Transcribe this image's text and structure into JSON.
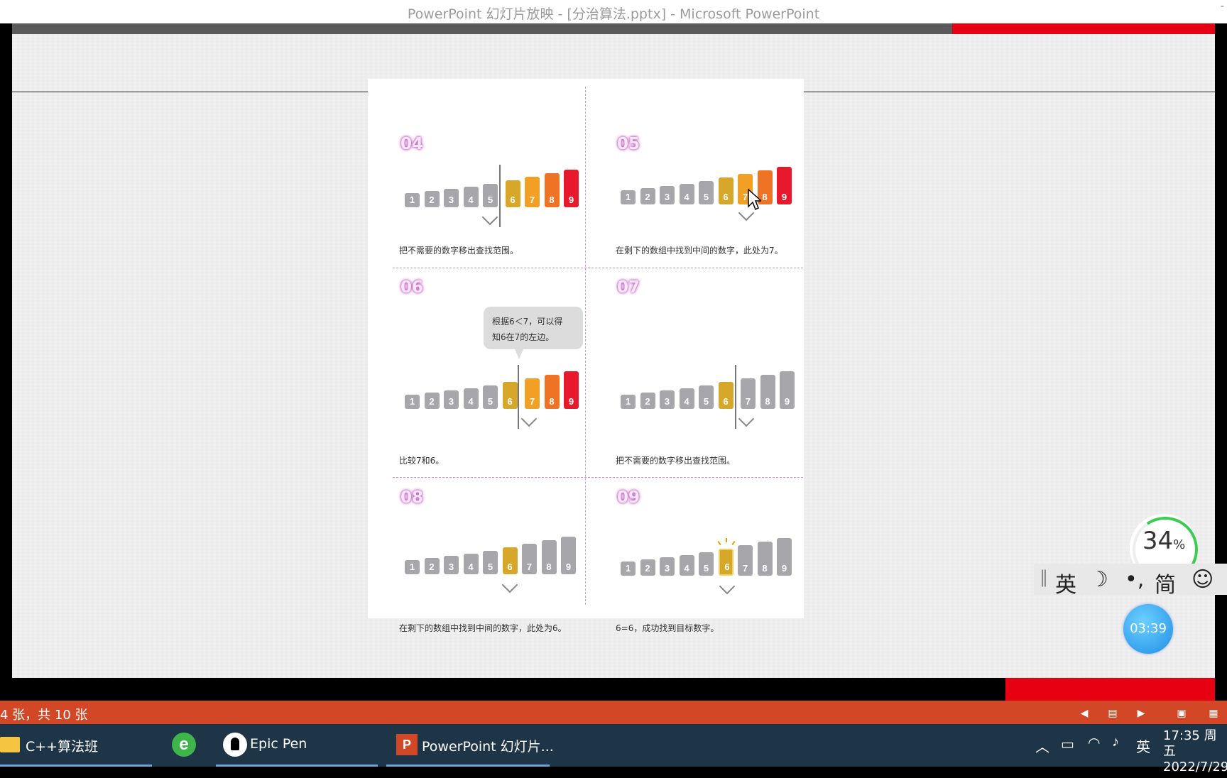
{
  "window": {
    "title": "PowerPoint 幻灯片放映 - [分治算法.pptx] - Microsoft PowerPoint",
    "corner": "-"
  },
  "slide": {
    "panels": [
      {
        "step": "04",
        "caption": "把不需要的数字移出查找范围。"
      },
      {
        "step": "05",
        "caption": "在剩下的数组中找到中间的数字，此处为7。"
      },
      {
        "step": "06",
        "caption": "比较7和6。",
        "bubble_line1": "根据6＜7，可以得",
        "bubble_line2": "知6在7的左边。"
      },
      {
        "step": "07",
        "caption": "把不需要的数字移出查找范围。"
      },
      {
        "step": "08",
        "caption": "在剩下的数组中找到中间的数字，此处为6。"
      },
      {
        "step": "09",
        "caption": "6=6，成功找到目标数字。"
      }
    ],
    "bar_labels": [
      "1",
      "2",
      "3",
      "4",
      "5",
      "6",
      "7",
      "8",
      "9"
    ],
    "colors": {
      "gray": "#a7a7ab",
      "gold": "#d7a72a",
      "amber": "#f2a024",
      "orange": "#ef7325",
      "red": "#e8192c"
    }
  },
  "statusbar": {
    "slide_info": "4 张，共 10 张"
  },
  "taskbar": {
    "items": [
      "C++算法班",
      "Epic Pen",
      "PowerPoint 幻灯片..."
    ],
    "tray_lang": "英",
    "time": "17:35 周五",
    "date": "2022/7/29"
  },
  "ime": {
    "mode": "英",
    "moon": "☽",
    "punct": "•,",
    "charset": "简",
    "emoji": "☺"
  },
  "widgets": {
    "percent": "34",
    "percent_unit": "%",
    "timer": "03:39"
  }
}
